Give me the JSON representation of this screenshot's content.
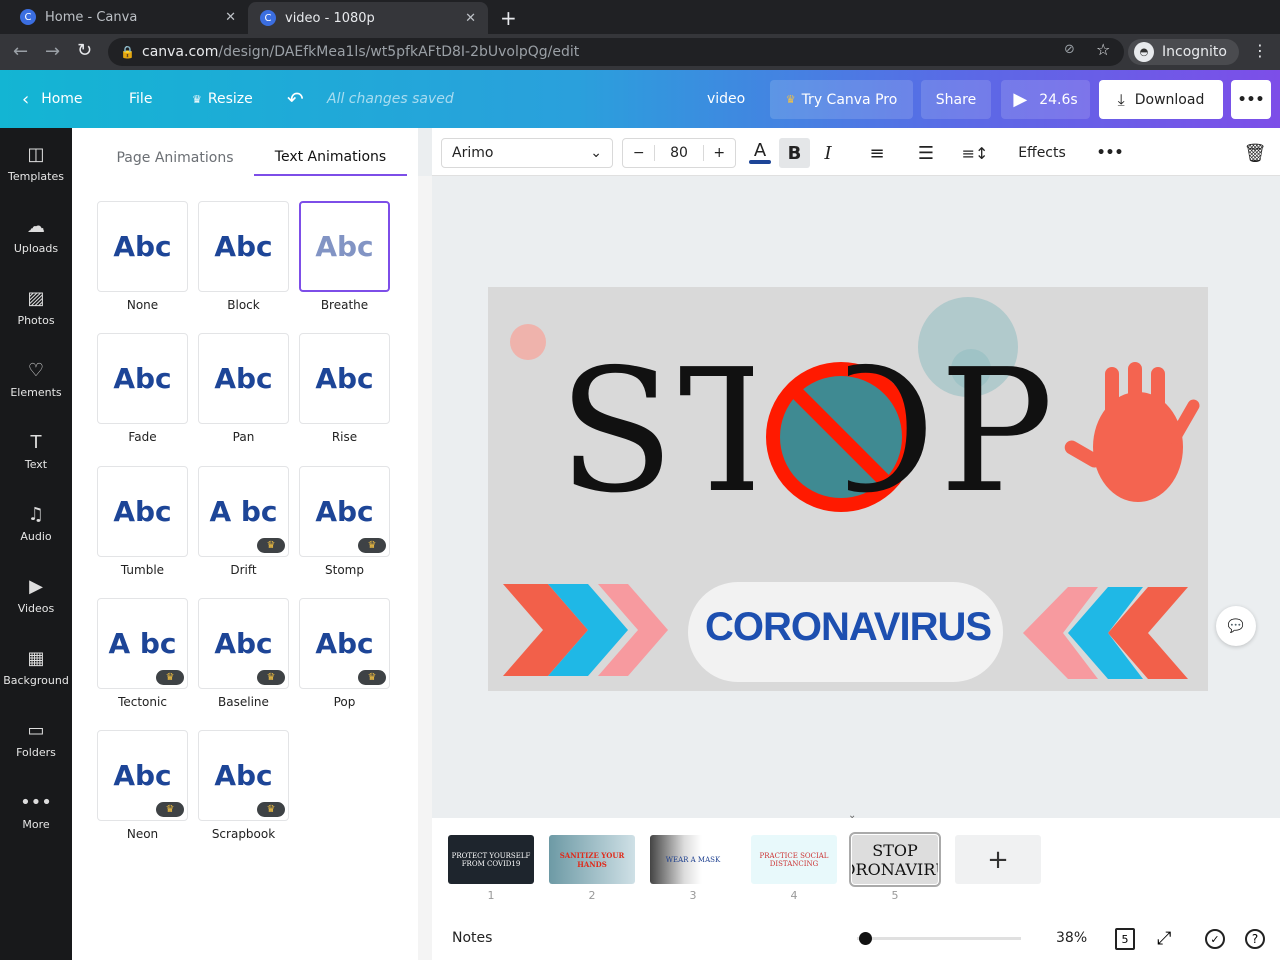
{
  "browser": {
    "tabs": [
      {
        "title": "Home - Canva"
      },
      {
        "title": "video - 1080p"
      }
    ],
    "url_host": "canva.com",
    "url_path": "/design/DAEfkMea1ls/wt5pfkAFtD8I-2bUvolpQg/edit",
    "profile": "Incognito"
  },
  "header": {
    "home": "Home",
    "file": "File",
    "resize": "Resize",
    "status": "All changes saved",
    "title": "video",
    "try_pro": "Try Canva Pro",
    "share": "Share",
    "duration": "24.6s",
    "download": "Download"
  },
  "sidebar": {
    "items": [
      {
        "label": "Templates",
        "icon": "templates-icon"
      },
      {
        "label": "Uploads",
        "icon": "upload-icon"
      },
      {
        "label": "Photos",
        "icon": "photo-icon"
      },
      {
        "label": "Elements",
        "icon": "elements-icon"
      },
      {
        "label": "Text",
        "icon": "text-icon"
      },
      {
        "label": "Audio",
        "icon": "music-icon"
      },
      {
        "label": "Videos",
        "icon": "video-icon"
      },
      {
        "label": "Background",
        "icon": "background-icon"
      },
      {
        "label": "Folders",
        "icon": "folder-icon"
      },
      {
        "label": "More",
        "icon": "more-icon"
      }
    ]
  },
  "panel": {
    "tabs": [
      "Page Animations",
      "Text Animations"
    ],
    "active_tab": "Text Animations",
    "preview": "Abc",
    "animations": [
      {
        "name": "None",
        "sample": "Abc",
        "pro": false
      },
      {
        "name": "Block",
        "sample": "Abc",
        "pro": false
      },
      {
        "name": "Breathe",
        "sample": "Abc",
        "pro": false,
        "selected": true
      },
      {
        "name": "Fade",
        "sample": "Abc",
        "pro": false
      },
      {
        "name": "Pan",
        "sample": "Abc",
        "pro": false
      },
      {
        "name": "Rise",
        "sample": "Abc",
        "pro": false
      },
      {
        "name": "Tumble",
        "sample": "Abc",
        "pro": false
      },
      {
        "name": "Drift",
        "sample": "A bc",
        "pro": true
      },
      {
        "name": "Stomp",
        "sample": "Abc",
        "pro": true
      },
      {
        "name": "Tectonic",
        "sample": "A bc",
        "pro": true
      },
      {
        "name": "Baseline",
        "sample": "Abc",
        "pro": true
      },
      {
        "name": "Pop",
        "sample": "Abc",
        "pro": true
      },
      {
        "name": "Neon",
        "sample": "Abc",
        "pro": true
      },
      {
        "name": "Scrapbook",
        "sample": "Abc",
        "pro": true
      }
    ]
  },
  "toolbar": {
    "font": "Arimo",
    "font_size": "80",
    "effects": "Effects",
    "text_color": "#1d4597"
  },
  "canvas": {
    "headline": "STOP",
    "subtitle": "CORONAVIRUS"
  },
  "pages": [
    {
      "num": "1",
      "text": "PROTECT YOURSELF FROM COVID19"
    },
    {
      "num": "2",
      "text": "SANITIZE YOUR HANDS"
    },
    {
      "num": "3",
      "text": "WEAR A MASK"
    },
    {
      "num": "4",
      "text": "PRACTICE SOCIAL DISTANCING"
    },
    {
      "num": "5",
      "text": "STOP CORONAVIRUS"
    }
  ],
  "footer": {
    "notes": "Notes",
    "zoom": "38%",
    "page_count": "5",
    "zoom_level": 0.05
  }
}
